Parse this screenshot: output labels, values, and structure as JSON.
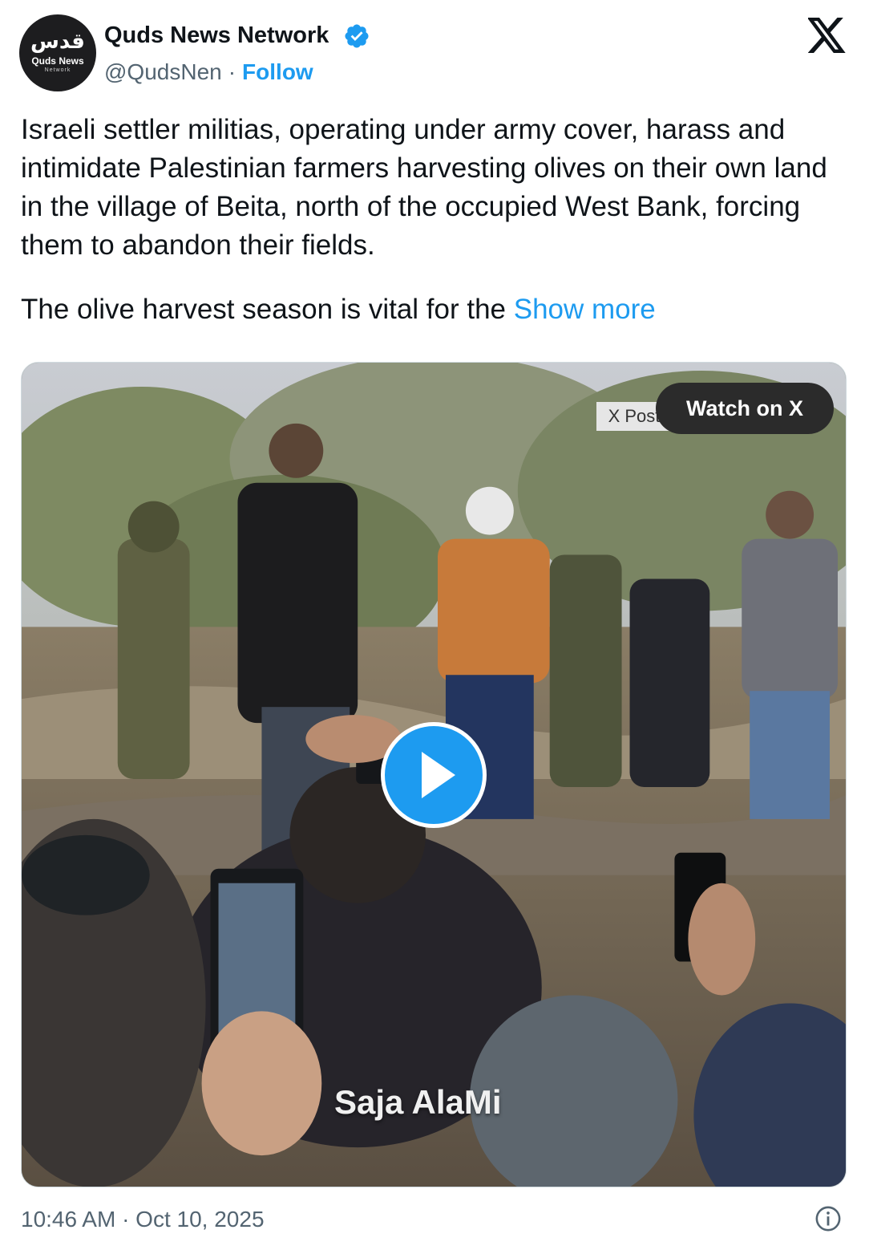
{
  "author": {
    "avatar_mark": "قدس",
    "avatar_line1": "Quds News",
    "avatar_line2": "Network",
    "name": "Quds News Network",
    "handle": "@QudsNen",
    "separator": "·",
    "follow_label": "Follow",
    "verified": true
  },
  "post": {
    "paragraph1": "Israeli settler militias, operating under army cover, harass and intimidate Palestinian farmers harvesting olives on their own land in the village of Beita, north of the occupied West Bank, forcing them to abandon their fields.",
    "paragraph2": "The olive harvest season is vital for the",
    "show_more": "Show more"
  },
  "media": {
    "tag": "X Post",
    "watch_label": "Watch on X",
    "watermark": "Saja AlaMi"
  },
  "footer": {
    "timestamp": "10:46 AM · Oct 10, 2025"
  },
  "icons": {
    "brand": "x-logo-icon",
    "verified": "verified-badge-icon",
    "play": "play-icon",
    "info": "info-icon"
  },
  "colors": {
    "accent": "#1d9bf0",
    "text": "#0f1419",
    "secondary": "#536471"
  }
}
